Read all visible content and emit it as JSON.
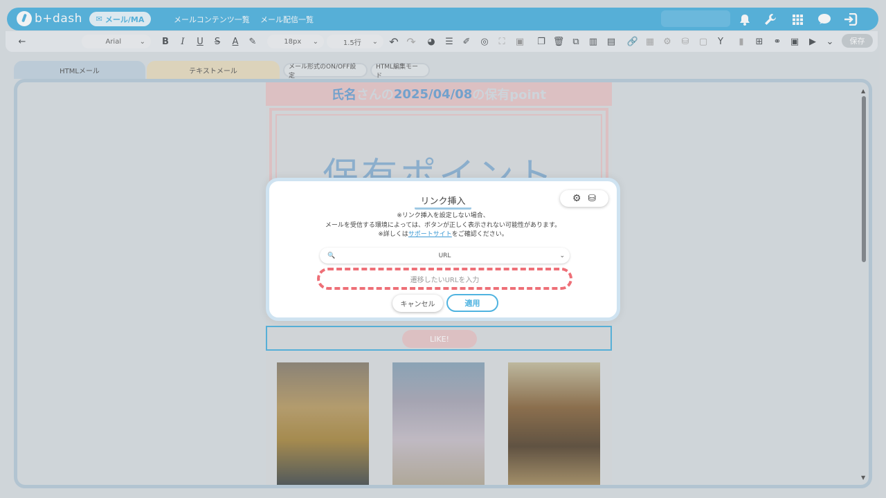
{
  "header": {
    "logo_text": "b+dash",
    "active_menu": "メール/MA",
    "links": [
      "メールコンテンツ一覧",
      "メール配信一覧"
    ],
    "icons": [
      "bell-icon",
      "wrench-icon",
      "grid-icon",
      "chat-icon",
      "logout-icon"
    ]
  },
  "toolbar": {
    "back": "←",
    "font": "Arial",
    "font_size": "18px",
    "line_height": "1.5行",
    "save_label": "保存"
  },
  "tabs": {
    "html_mail": "HTMLメール",
    "text_mail": "テキストメール",
    "onoff": "メール形式のON/OFF設定",
    "html_edit": "HTML編集モード"
  },
  "email": {
    "header_name": "氏名",
    "header_mid": "さんの",
    "header_date": "2025/04/08",
    "header_suffix": "の保有point",
    "point_title": "保有ポイント",
    "like_label": "LIKE!"
  },
  "modal": {
    "title": "リンク挿入",
    "notice_line1": "※リンク挿入を設定しない場合、",
    "notice_line2": "メールを受信する環境によっては、ボタンが正しく表示されない可能性があります。",
    "notice_line3_prefix": "※詳しくは",
    "notice_link": "サポートサイト",
    "notice_line3_suffix": "をご確認ください。",
    "select_value": "URL",
    "input_placeholder": "遷移したいURLを入力",
    "cancel_label": "キャンセル",
    "apply_label": "適用"
  },
  "colors": {
    "brand": "#4fb3e0",
    "danger_dashed": "#ee6f77",
    "email_pink": "#e8c6c8"
  }
}
